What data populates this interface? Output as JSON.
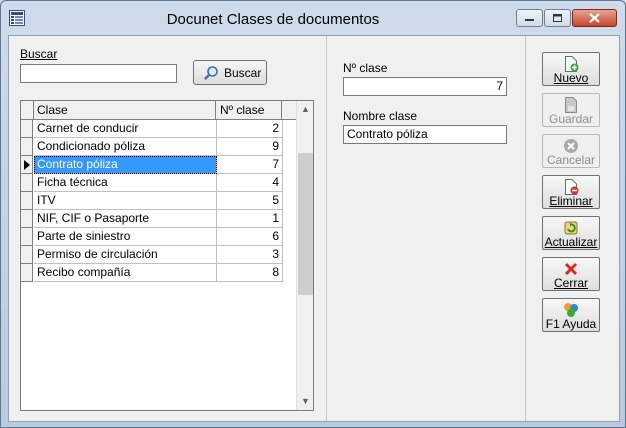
{
  "window": {
    "title": "Docunet Clases de documentos"
  },
  "search": {
    "label": "Buscar",
    "value": "",
    "button_label": "Buscar"
  },
  "grid": {
    "columns": [
      "Clase",
      "Nº clase"
    ],
    "rows": [
      {
        "clase": "Carnet de conducir",
        "num": "2"
      },
      {
        "clase": "Condicionado póliza",
        "num": "9"
      },
      {
        "clase": "Contrato póliza",
        "num": "7"
      },
      {
        "clase": "Ficha técnica",
        "num": "4"
      },
      {
        "clase": "ITV",
        "num": "5"
      },
      {
        "clase": "NIF, CIF o Pasaporte",
        "num": "1"
      },
      {
        "clase": "Parte de siniestro",
        "num": "6"
      },
      {
        "clase": "Permiso de circulación",
        "num": "3"
      },
      {
        "clase": "Recibo compañía",
        "num": "8"
      }
    ],
    "selected_index": 2
  },
  "detail": {
    "num_label": "Nº clase",
    "num_value": "7",
    "name_label": "Nombre clase",
    "name_value": "Contrato póliza"
  },
  "toolbar": {
    "nuevo": "Nuevo",
    "guardar": "Guardar",
    "cancelar": "Cancelar",
    "eliminar": "Eliminar",
    "actualizar": "Actualizar",
    "cerrar": "Cerrar",
    "ayuda": "F1 Ayuda"
  },
  "colors": {
    "selection": "#3399ff",
    "close_button": "#c7462b"
  },
  "icons": [
    "app-icon",
    "minimize-icon",
    "maximize-icon",
    "close-icon",
    "search-icon",
    "new-document-icon",
    "save-icon",
    "cancel-icon",
    "delete-document-icon",
    "refresh-icon",
    "cross-icon",
    "help-icon"
  ]
}
